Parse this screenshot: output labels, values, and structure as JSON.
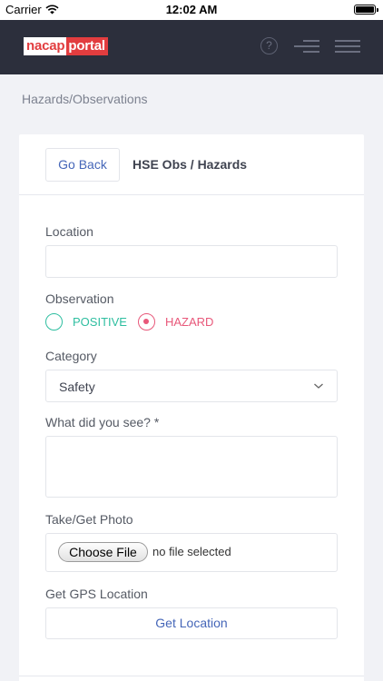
{
  "status_bar": {
    "carrier": "Carrier",
    "time": "12:02 AM"
  },
  "header": {
    "logo_part1": "nacap",
    "logo_part2": "portal",
    "help_glyph": "?"
  },
  "breadcrumb": "Hazards/Observations",
  "card": {
    "go_back_label": "Go Back",
    "title": "HSE Obs / Hazards"
  },
  "form": {
    "location_label": "Location",
    "location_value": "",
    "observation_label": "Observation",
    "observation_options": [
      {
        "label": "POSITIVE",
        "selected": false,
        "color": "#2ebea0"
      },
      {
        "label": "HAZARD",
        "selected": true,
        "color": "#e8587a"
      }
    ],
    "category_label": "Category",
    "category_value": "Safety",
    "what_label": "What did you see? *",
    "what_value": "",
    "photo_label": "Take/Get Photo",
    "choose_file_label": "Choose File",
    "file_status": "no file selected",
    "gps_label": "Get GPS Location",
    "get_location_label": "Get Location"
  },
  "colors": {
    "header_bg": "#2c2f3c",
    "accent_blue": "#4566b8",
    "logo_red": "#e23d3f"
  },
  "icons": [
    "wifi-icon",
    "battery-icon",
    "help-icon",
    "menu-icon",
    "chevron-down-icon"
  ]
}
